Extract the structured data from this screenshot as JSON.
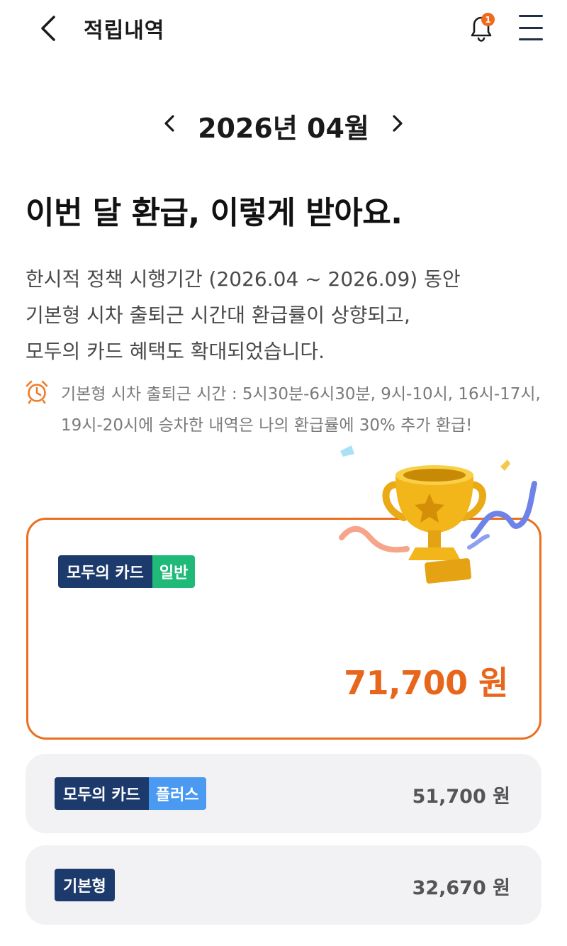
{
  "header": {
    "title": "적립내역",
    "notification_count": "1"
  },
  "month_nav": {
    "label": "2026년 04월"
  },
  "headline": "이번 달 환급, 이렇게 받아요.",
  "description": [
    "한시적 정책 시행기간 (2026.04 ~ 2026.09) 동안",
    "기본형 시차 출퇴근 시간대 환급률이 상향되고,",
    "모두의 카드 혜택도 확대되었습니다."
  ],
  "notice": {
    "icon": "alarm-clock-icon",
    "text": "기본형 시차 출퇴근 시간 : 5시30분-6시30분, 9시-10시, 16시-17시, 19시-20시에 승차한 내역은 나의 환급률에 30% 추가 환급!"
  },
  "cards": {
    "general": {
      "brand": "모두의 카드",
      "type": "일반",
      "amount": "71,700 원"
    },
    "plus": {
      "brand": "모두의 카드",
      "type": "플러스",
      "amount": "51,700 원"
    },
    "basic": {
      "type": "기본형",
      "amount": "32,670 원"
    }
  },
  "colors": {
    "accent": "#e8661b",
    "navy": "#1c3a6b",
    "green": "#1fba78",
    "blue": "#4a9af2"
  }
}
